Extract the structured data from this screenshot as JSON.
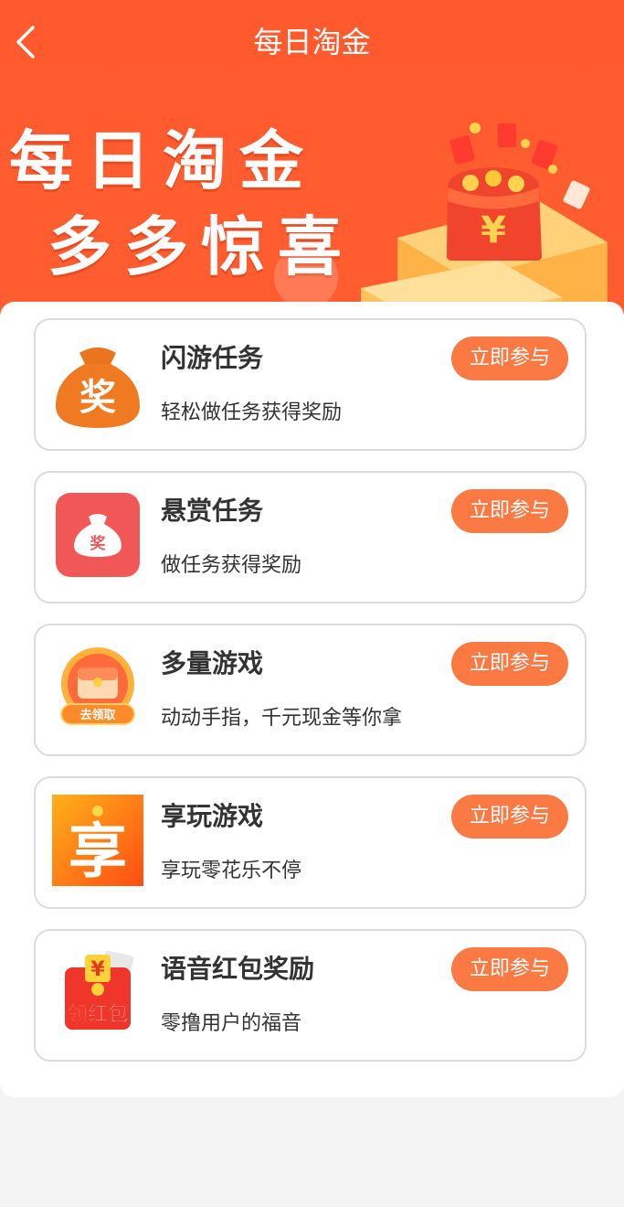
{
  "header": {
    "title": "每日淘金"
  },
  "banner": {
    "line1": "每日淘金",
    "line2": "多多惊喜",
    "yuan_symbol": "¥"
  },
  "tasks": [
    {
      "title": "闪游任务",
      "desc": "轻松做任务获得奖励",
      "button": "立即参与",
      "icon": "money-bag-icon",
      "icon_text": "奖"
    },
    {
      "title": "悬赏任务",
      "desc": "做任务获得奖励",
      "button": "立即参与",
      "icon": "reward-bag-icon",
      "icon_text": "奖"
    },
    {
      "title": "多量游戏",
      "desc": "动动手指，千元现金等你拿",
      "button": "立即参与",
      "icon": "treasure-chest-icon",
      "icon_text": "去领取"
    },
    {
      "title": "享玩游戏",
      "desc": "享玩零花乐不停",
      "button": "立即参与",
      "icon": "xiang-icon",
      "icon_text": "享"
    },
    {
      "title": "语音红包奖励",
      "desc": "零撸用户的福音",
      "button": "立即参与",
      "icon": "red-envelope-icon",
      "icon_text": "领红包",
      "icon_symbol": "¥"
    }
  ],
  "colors": {
    "primary": "#ff5a2e",
    "button": "#fb7a43",
    "border": "#dcdcdc"
  }
}
